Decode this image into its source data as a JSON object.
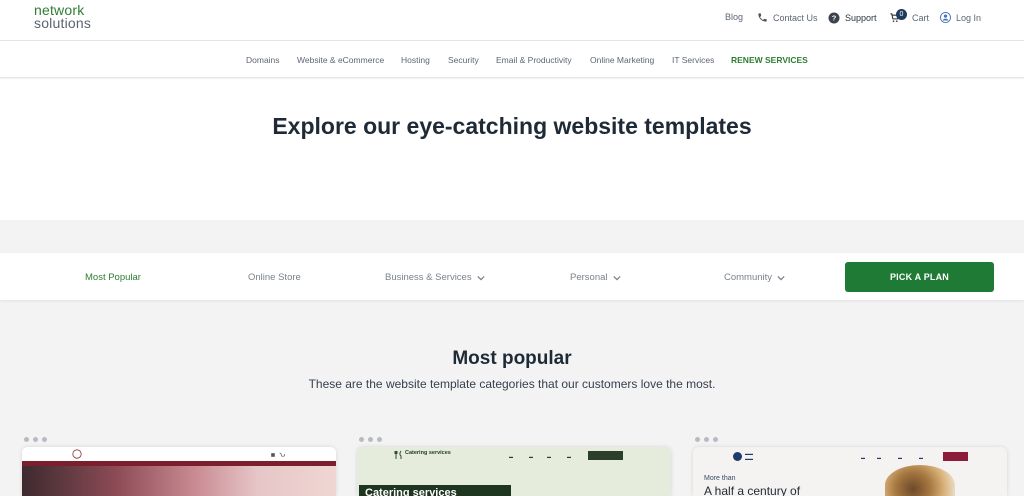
{
  "header": {
    "logo_line1": "network",
    "logo_line2": "solutions",
    "blog": "Blog",
    "contact": "Contact Us",
    "support": "Support",
    "cart_count": "0",
    "cart": "Cart",
    "login": "Log In"
  },
  "nav": {
    "items": [
      "Domains",
      "Website & eCommerce",
      "Hosting",
      "Security",
      "Email & Productivity",
      "Online Marketing",
      "IT Services",
      "RENEW SERVICES"
    ]
  },
  "hero": {
    "title": "Explore our eye-catching website templates"
  },
  "filters": {
    "items": [
      "Most Popular",
      "Online Store",
      "Business & Services",
      "Personal",
      "Community"
    ],
    "cta": "PICK A PLAN"
  },
  "section": {
    "title": "Most popular",
    "subtitle": "These are the website template categories that our customers love the most."
  },
  "cards": {
    "card2_heading": "Catering services",
    "card2_logo": "Catering services",
    "card3_more": "More than",
    "card3_heading": "A half a century of"
  },
  "colors": {
    "brand_green": "#1e7a34",
    "text_dark": "#1f2a37",
    "page_bg": "#f3f3f4"
  }
}
